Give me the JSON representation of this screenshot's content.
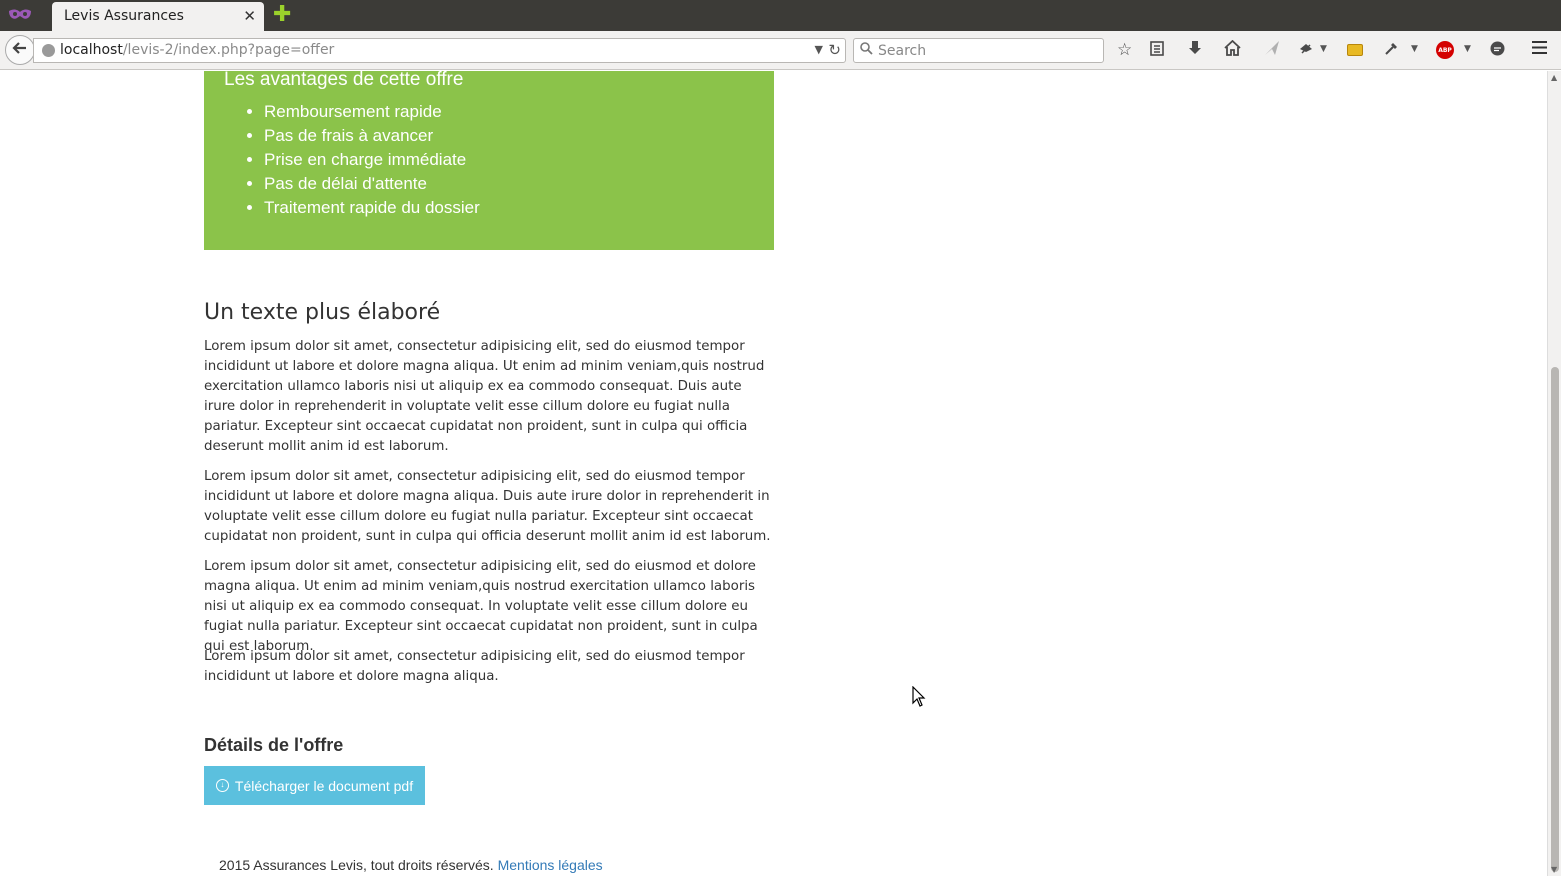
{
  "browser": {
    "tab_title": "Levis Assurances",
    "tab_close_icon": "✕",
    "new_tab_icon": "✚",
    "url_host": "localhost",
    "url_path": "/levis-2/index.php?page=offer",
    "search_placeholder": "Search"
  },
  "page": {
    "advantages_title": "Les avantages de cette offre",
    "advantages": [
      "Remboursement rapide",
      "Pas de frais à avancer",
      "Prise en charge immédiate",
      "Pas de délai d'attente",
      "Traitement rapide du dossier"
    ],
    "section_title": "Un texte plus élaboré",
    "paragraphs": [
      "Lorem ipsum dolor sit amet, consectetur adipisicing elit, sed do eiusmod tempor incididunt ut labore et dolore magna aliqua. Ut enim ad minim veniam,quis nostrud exercitation ullamco laboris nisi ut aliquip ex ea commodo consequat. Duis aute irure dolor in reprehenderit in voluptate velit esse cillum dolore eu fugiat nulla pariatur. Excepteur sint occaecat cupidatat non proident, sunt in culpa qui officia deserunt mollit anim id est laborum.",
      "Lorem ipsum dolor sit amet, consectetur adipisicing elit, sed do eiusmod tempor incididunt ut labore et dolore magna aliqua. Duis aute irure dolor in reprehenderit in voluptate velit esse cillum dolore eu fugiat nulla pariatur. Excepteur sint occaecat cupidatat non proident, sunt in culpa qui officia deserunt mollit anim id est laborum.",
      "Lorem ipsum dolor sit amet, consectetur adipisicing elit, sed do eiusmod et dolore magna aliqua. Ut enim ad minim veniam,quis nostrud exercitation ullamco laboris nisi ut aliquip ex ea commodo consequat. In voluptate velit esse cillum dolore eu fugiat nulla pariatur. Excepteur sint occaecat cupidatat non proident, sunt in culpa qui est laborum.",
      "Lorem ipsum dolor sit amet, consectetur adipisicing elit, sed do eiusmod tempor incididunt ut labore et dolore magna aliqua."
    ],
    "details_title": "Détails de l'offre",
    "pdf_button_label": "Télécharger le document pdf",
    "footer_text": "2015 Assurances Levis, tout droits réservés.",
    "legal_link": "Mentions légales"
  },
  "icons": {
    "back": "arrow-left-icon",
    "reload": "reload-icon",
    "bookmark_star": "star-icon",
    "reading_list": "clipboard-icon",
    "downloads": "download-arrow-icon",
    "home": "home-icon",
    "abp_label": "ABP"
  },
  "colors": {
    "advantages_bg": "#8bc34a",
    "button_bg": "#5bc0de",
    "link": "#337ab7",
    "titlebar": "#3c3b37"
  }
}
